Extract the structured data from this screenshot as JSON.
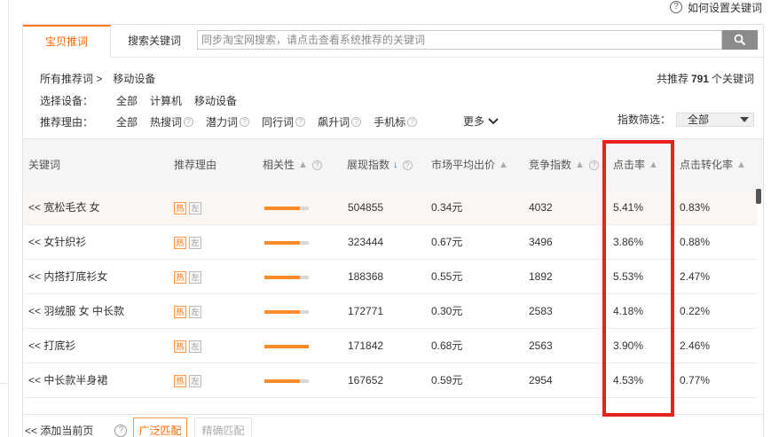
{
  "help_link": "如何设置关键词",
  "tabs": [
    {
      "label": "宝贝推词",
      "active": true
    },
    {
      "label": "搜索关键词",
      "active": false
    }
  ],
  "search": {
    "placeholder": "同步淘宝网搜索，请点击查看系统推荐的关键词",
    "icon": "search-icon"
  },
  "breadcrumb": {
    "root": "所有推荐词 >",
    "current": "移动设备"
  },
  "total": {
    "prefix": "共推荐",
    "count": "791",
    "suffix": "个关键词"
  },
  "device_filter": {
    "label": "选择设备：",
    "options": [
      "全部",
      "计算机",
      "移动设备"
    ]
  },
  "reason_filter": {
    "label": "推荐理由：",
    "options": [
      "全部",
      "热搜词",
      "潜力词",
      "同行词",
      "飙升词",
      "手机标"
    ],
    "more": "更多"
  },
  "index_filter": {
    "label": "指数筛选：",
    "value": "全部"
  },
  "columns": [
    "关键词",
    "推荐理由",
    "相关性",
    "展现指数",
    "市场平均出价",
    "竞争指数",
    "点击率",
    "点击转化率"
  ],
  "rows": [
    {
      "keyword": "<< 宽松毛衣 女",
      "tags": [
        "热",
        "左"
      ],
      "relevance": 0.8,
      "impression": "504855",
      "avg_bid": "0.34元",
      "competition": "4032",
      "ctr": "5.41%",
      "cvr": "0.83%"
    },
    {
      "keyword": "<< 女针织衫",
      "tags": [
        "热",
        "左"
      ],
      "relevance": 0.8,
      "impression": "323444",
      "avg_bid": "0.67元",
      "competition": "3496",
      "ctr": "3.86%",
      "cvr": "0.88%"
    },
    {
      "keyword": "<< 内搭打底衫女",
      "tags": [
        "热",
        "左"
      ],
      "relevance": 0.8,
      "impression": "188368",
      "avg_bid": "0.55元",
      "competition": "1892",
      "ctr": "5.53%",
      "cvr": "2.47%"
    },
    {
      "keyword": "<< 羽绒服 女 中长款",
      "tags": [
        "热",
        "左"
      ],
      "relevance": 0.8,
      "impression": "172771",
      "avg_bid": "0.30元",
      "competition": "2583",
      "ctr": "4.18%",
      "cvr": "0.22%"
    },
    {
      "keyword": "<< 打底衫",
      "tags": [
        "热",
        "左"
      ],
      "relevance": 1.0,
      "impression": "171842",
      "avg_bid": "0.68元",
      "competition": "2563",
      "ctr": "3.90%",
      "cvr": "2.46%"
    },
    {
      "keyword": "<< 中长款半身裙",
      "tags": [
        "热",
        "左"
      ],
      "relevance": 0.8,
      "impression": "167652",
      "avg_bid": "0.59元",
      "competition": "2954",
      "ctr": "4.53%",
      "cvr": "0.77%"
    }
  ],
  "footer": {
    "add_current": "<< 添加当前页",
    "broad_match": "广泛匹配",
    "exact_match": "精确匹配"
  },
  "colors": {
    "accent": "#ff6600",
    "highlight_box": "#e8231f",
    "sort_active": "#1a73e8"
  }
}
